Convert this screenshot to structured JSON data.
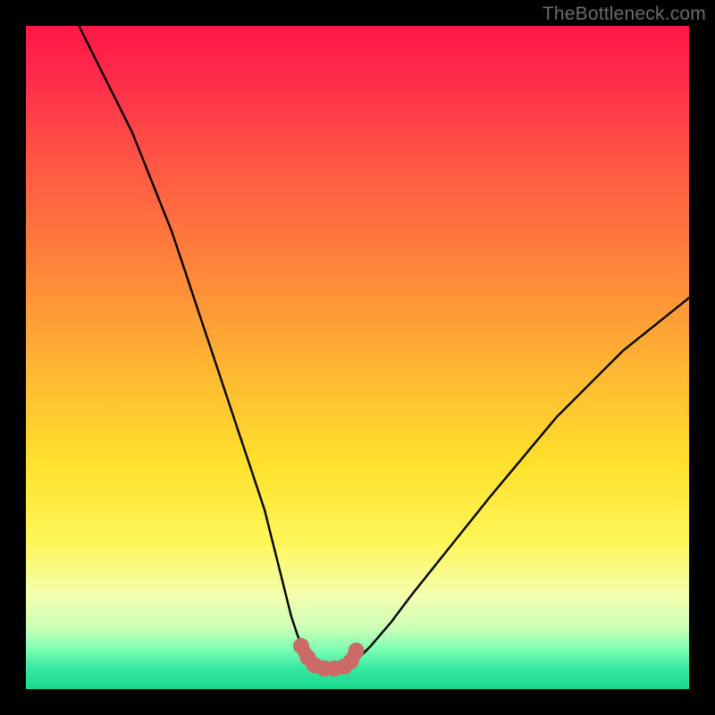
{
  "watermark": "TheBottleneck.com",
  "chart_data": {
    "type": "line",
    "title": "",
    "xlabel": "",
    "ylabel": "",
    "xlim": [
      0,
      100
    ],
    "ylim": [
      0,
      100
    ],
    "series": [
      {
        "name": "bottleneck-curve",
        "x": [
          8,
          10,
          12,
          14,
          16,
          18,
          20,
          22,
          24,
          26,
          28,
          30,
          32,
          34,
          36,
          37,
          38,
          39,
          40,
          41,
          42,
          43,
          44,
          46,
          47,
          48,
          50,
          52,
          55,
          58,
          62,
          66,
          70,
          75,
          80,
          85,
          90,
          95,
          100
        ],
        "values": [
          100,
          96,
          92,
          88,
          84,
          79,
          74,
          69,
          63,
          57,
          51,
          45,
          39,
          33,
          27,
          23,
          19,
          15,
          11,
          8,
          6,
          4.5,
          3.5,
          3,
          3,
          3.5,
          4.5,
          6.5,
          10,
          14,
          19,
          24,
          29,
          35,
          41,
          46,
          51,
          55,
          59
        ]
      }
    ],
    "flat_region": {
      "x_start": 42,
      "x_end": 49,
      "y": 3.2
    },
    "flat_region_markers": [
      {
        "x": 41.5,
        "y": 6.5
      },
      {
        "x": 42.5,
        "y": 4.8
      },
      {
        "x": 43.5,
        "y": 3.6
      },
      {
        "x": 45.0,
        "y": 3.1
      },
      {
        "x": 46.5,
        "y": 3.1
      },
      {
        "x": 48.0,
        "y": 3.4
      },
      {
        "x": 49.0,
        "y": 4.2
      },
      {
        "x": 49.8,
        "y": 5.8
      }
    ],
    "marker_color": "#cc6a68",
    "curve_color": "#000000"
  }
}
